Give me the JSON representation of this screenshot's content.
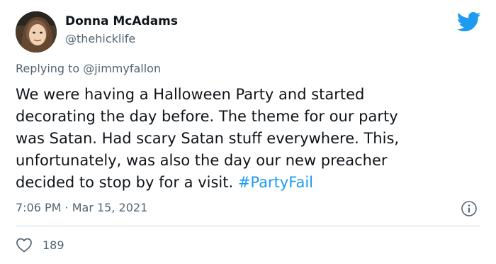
{
  "author": {
    "display_name": "Donna McAdams",
    "handle": "@thehicklife",
    "avatar_icon": "user-avatar-photo"
  },
  "platform": {
    "logo_icon": "twitter-bird-icon",
    "brand_color": "#1d9bf0"
  },
  "reply": {
    "prefix": "Replying to ",
    "mention": "@jimmyfallon"
  },
  "tweet": {
    "text_line1": "We were having a Halloween Party and started",
    "text_line2": "decorating the day before. The theme for our party",
    "text_line3": "was Satan. Had scary Satan stuff everywhere. This,",
    "text_line4": "unfortunately, was also the day our new preacher",
    "text_line5": "decided to stop by for a visit. ",
    "hashtag": "#PartyFail"
  },
  "meta": {
    "timestamp": "7:06 PM · Mar 15, 2021",
    "info_icon": "info-icon"
  },
  "engagement": {
    "like_icon": "heart-icon",
    "like_count": "189"
  }
}
